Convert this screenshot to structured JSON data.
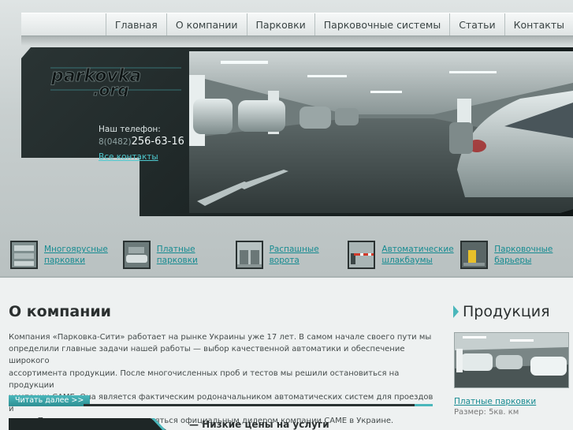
{
  "nav": {
    "items": [
      {
        "label": "Главная"
      },
      {
        "label": "О компании"
      },
      {
        "label": "Парковки"
      },
      {
        "label": "Парковочные системы"
      },
      {
        "label": "Статьи"
      },
      {
        "label": "Контакты"
      }
    ]
  },
  "header": {
    "logo_line1": "parkovka",
    "logo_line2": ".org",
    "phone_label": "Наш телефон:",
    "phone_code": "8(0482)",
    "phone_number": "256-63-16",
    "contacts_link": "Все контакты"
  },
  "categories": [
    {
      "line1": "Многоярусные",
      "line2": "парковки",
      "icon": "multilevel-parking-thumb"
    },
    {
      "line1": "Платные",
      "line2": "парковки",
      "icon": "paid-parking-thumb"
    },
    {
      "line1": "Распашные",
      "line2": "ворота",
      "icon": "swing-gates-thumb"
    },
    {
      "line1": "Автоматические",
      "line2": "шлакбаумы",
      "icon": "barrier-thumb"
    },
    {
      "line1": "Парковочные",
      "line2": "барьеры",
      "icon": "parking-barriers-thumb"
    }
  ],
  "about": {
    "title": "О компании",
    "lines": [
      "Компания «Парковка-Сити» работает на рынке Украины уже 17 лет. В самом начале своего пути мы",
      "определили главные задачи нашей работы — выбор качественной автоматики и обеспечение широкого",
      "ассортимента продукции. После многочисленных проб и тестов мы решили остановиться на продукции",
      "компании CAME. Она является фактическим родоначальником автоматических систем для проездов и",
      "ворот. Поэтому мы очень рады являться официальным дилером компании CAME в Украине."
    ],
    "read_more": "Читать далее >>",
    "low_prices": "—   Низкие цены на услуги"
  },
  "products": {
    "title": "Продукция",
    "item_link": "Платные парковки",
    "item_size": "Размер: 5кв. км"
  },
  "colors": {
    "accent": "#4ab7bb",
    "link": "#168b91",
    "dark": "#1e2626"
  }
}
